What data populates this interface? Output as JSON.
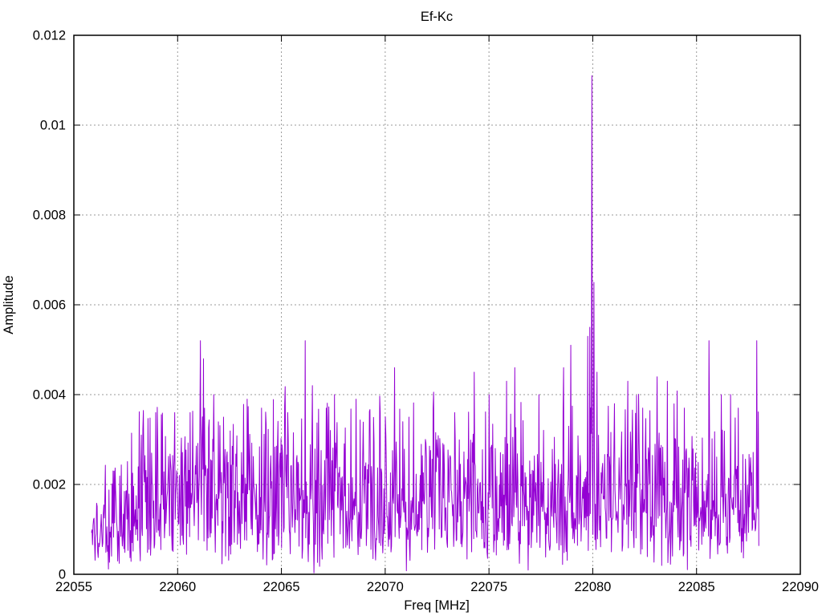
{
  "chart_data": {
    "type": "line",
    "title": "Ef-Kc",
    "xlabel": "Freq [MHz]",
    "ylabel": "Amplitude",
    "xlim": [
      22055,
      22090
    ],
    "ylim": [
      0,
      0.012
    ],
    "x_ticks": {
      "values": [
        22055,
        22060,
        22065,
        22070,
        22075,
        22080,
        22085,
        22090
      ],
      "labels": [
        "22055",
        "22060",
        "22065",
        "22070",
        "22075",
        "22080",
        "22085",
        "22090"
      ]
    },
    "y_ticks": {
      "values": [
        0,
        0.002,
        0.004,
        0.006,
        0.008,
        0.01,
        0.012
      ],
      "labels": [
        "0",
        "0.002",
        "0.004",
        "0.006",
        "0.008",
        "0.01",
        "0.012"
      ]
    },
    "grid": {
      "on": true,
      "color": "#9a9a9a",
      "style": "dotted",
      "mirrored_ticks": true
    },
    "background": "#ffffff",
    "border_color": "#000000",
    "legend": "none",
    "series": [
      {
        "name": "Ef-Kc",
        "color": "#9400d3",
        "x_start": 22055.85,
        "x_end": 22088.0,
        "n_points": 1300,
        "noise_model": {
          "distribution": "rayleigh",
          "sigma": 0.0014,
          "seed": 20880,
          "ramp_end": 22058.4,
          "ramp_start_factor": 0.42,
          "soft_clip_knee": 0.0036,
          "soft_clip_ratio": 0.38,
          "baseline_mean": 0.0017,
          "baseline_range": [
            0.0001,
            0.0039
          ]
        },
        "main_peak": {
          "freq": 22079.95,
          "amplitude": 0.0111
        },
        "peaks": [
          [
            22056.95,
            0.0023
          ],
          [
            22058.25,
            0.0031
          ],
          [
            22058.95,
            0.0036
          ],
          [
            22059.85,
            0.0036
          ],
          [
            22060.6,
            0.0036
          ],
          [
            22061.1,
            0.0052
          ],
          [
            22061.25,
            0.0048
          ],
          [
            22061.75,
            0.004
          ],
          [
            22062.2,
            0.0035
          ],
          [
            22063.35,
            0.0039
          ],
          [
            22064.05,
            0.0037
          ],
          [
            22065.3,
            0.0036
          ],
          [
            22066.15,
            0.0052
          ],
          [
            22066.5,
            0.0042
          ],
          [
            22067.15,
            0.0037
          ],
          [
            22067.55,
            0.004
          ],
          [
            22068.6,
            0.0039
          ],
          [
            22070.45,
            0.0046
          ],
          [
            22071.15,
            0.0035
          ],
          [
            22072.3,
            0.0037
          ],
          [
            22073.35,
            0.0036
          ],
          [
            22074.3,
            0.0045
          ],
          [
            22075.0,
            0.004
          ],
          [
            22075.85,
            0.0043
          ],
          [
            22076.25,
            0.0046
          ],
          [
            22077.4,
            0.004
          ],
          [
            22078.6,
            0.0046
          ],
          [
            22078.95,
            0.0051
          ],
          [
            22079.75,
            0.0053
          ],
          [
            22079.85,
            0.0055
          ],
          [
            22079.95,
            0.0111
          ],
          [
            22080.05,
            0.0065
          ],
          [
            22080.2,
            0.0045
          ],
          [
            22081.05,
            0.0038
          ],
          [
            22081.7,
            0.0043
          ],
          [
            22082.4,
            0.0037
          ],
          [
            22083.6,
            0.0043
          ],
          [
            22084.4,
            0.0037
          ],
          [
            22085.6,
            0.0052
          ],
          [
            22086.2,
            0.004
          ],
          [
            22087.0,
            0.0037
          ],
          [
            22087.9,
            0.0052
          ]
        ]
      }
    ]
  }
}
